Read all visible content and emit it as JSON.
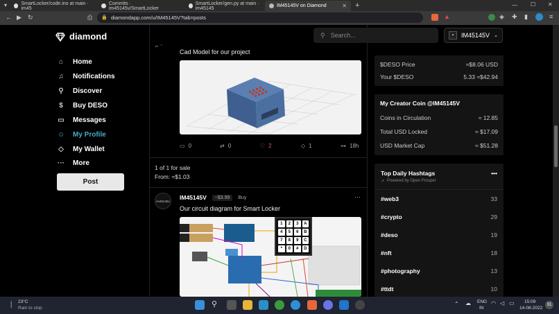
{
  "browser": {
    "tabs": [
      {
        "label": "SmartLocker/code.ino at main · im45"
      },
      {
        "label": "Commits · im45145v/SmartLocker"
      },
      {
        "label": "SmartLocker/gen.py at main · im45145"
      },
      {
        "label": "IM45145V on Diamond"
      }
    ],
    "url": "diamondapp.com/u/IM45145V?tab=posts"
  },
  "app": {
    "name": "diamond"
  },
  "search": {
    "placeholder": "Search..."
  },
  "user": {
    "name": "IM45145V"
  },
  "nav": [
    {
      "label": "Home",
      "icon": "home-icon"
    },
    {
      "label": "Notifications",
      "icon": "bell-icon"
    },
    {
      "label": "Discover",
      "icon": "person-search-icon"
    },
    {
      "label": "Buy DESO",
      "icon": "dollar-icon"
    },
    {
      "label": "Messages",
      "icon": "message-icon"
    },
    {
      "label": "My Profile",
      "icon": "user-icon"
    },
    {
      "label": "My Wallet",
      "icon": "diamond-icon"
    },
    {
      "label": "More",
      "icon": "more-icon"
    }
  ],
  "post_button": "Post",
  "post1": {
    "text": "Cad Model for our project",
    "comments": "0",
    "reposts": "0",
    "likes": "2",
    "diamonds": "1",
    "time": "18h"
  },
  "sale": {
    "line1": "1 of 1 for sale",
    "line2": "From: ≈$1.03"
  },
  "post2": {
    "author": "IM45145V",
    "coin_price": "~$3.99",
    "buy_label": "Buy",
    "text": "Our circuit diagram for Smart Locker",
    "avatar_text": "im45145v"
  },
  "keypad_keys": [
    "1",
    "2",
    "3",
    "A",
    "4",
    "5",
    "6",
    "B",
    "7",
    "8",
    "9",
    "C",
    "*",
    "0",
    "#",
    "D"
  ],
  "wallet": {
    "deso_price_label": "$DESO Price",
    "deso_price": "≈$8.06 USD",
    "your_deso_label": "Your $DESO",
    "your_deso": "5.33 ≈$42.94"
  },
  "creator_coin": {
    "title": "My Creator Coin @IM45145V",
    "rows": [
      {
        "label": "Coins in Circulation",
        "value": "≈ 12.85"
      },
      {
        "label": "Total USD Locked",
        "value": "≈ $17.09"
      },
      {
        "label": "USD Market Cap",
        "value": "≈ $51.28"
      }
    ]
  },
  "hashtags": {
    "title": "Top Daily Hashtags",
    "powered": "Powered by Open Prosper",
    "items": [
      {
        "tag": "#web3",
        "count": "33"
      },
      {
        "tag": "#crypto",
        "count": "29"
      },
      {
        "tag": "#deso",
        "count": "19"
      },
      {
        "tag": "#nft",
        "count": "18"
      },
      {
        "tag": "#photography",
        "count": "13"
      },
      {
        "tag": "#ttdt",
        "count": "10"
      }
    ]
  },
  "taskbar": {
    "temp": "23°C",
    "weather": "Rain to stop",
    "lang1": "ENG",
    "lang2": "IN",
    "time": "15:09",
    "date": "14-08-2022",
    "notif": "31"
  },
  "colors": {
    "accent": "#49a9c9",
    "like": "#e05a6b"
  }
}
